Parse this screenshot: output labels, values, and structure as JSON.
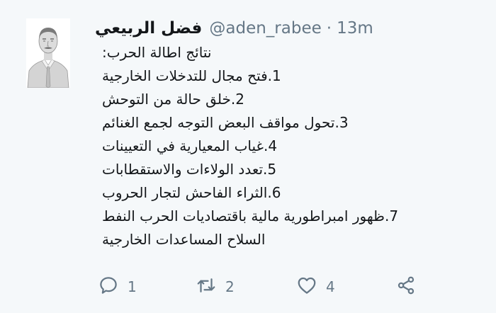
{
  "tweet": {
    "display_name": "فضل الربيعي",
    "handle": "@aden_rabee",
    "separator": "·",
    "time": "13m",
    "lines": [
      "نتائج اطالة الحرب:",
      "1.فتح مجال للتدخلات الخارجية",
      "2.خلق حالة من التوحش",
      "3.تحول مواقف البعض التوجه لجمع الغنائم",
      "4.غياب المعيارية في التعيينات",
      "5.تعدد الولاءات والاستقطابات",
      "6.الثراء الفاحش لتجار الحروب",
      "7.ظهور امبراطورية مالية باقتصاديات الحرب النفط",
      "السلاح  المساعدات الخارجية"
    ]
  },
  "actions": {
    "reply": {
      "icon": "reply-icon",
      "count": "1"
    },
    "retweet": {
      "icon": "retweet-icon",
      "count": "2"
    },
    "like": {
      "icon": "heart-icon",
      "count": "4"
    },
    "share": {
      "icon": "share-icon"
    }
  },
  "colors": {
    "background": "#f5f8fa",
    "text": "#14171a",
    "secondary": "#657786"
  }
}
